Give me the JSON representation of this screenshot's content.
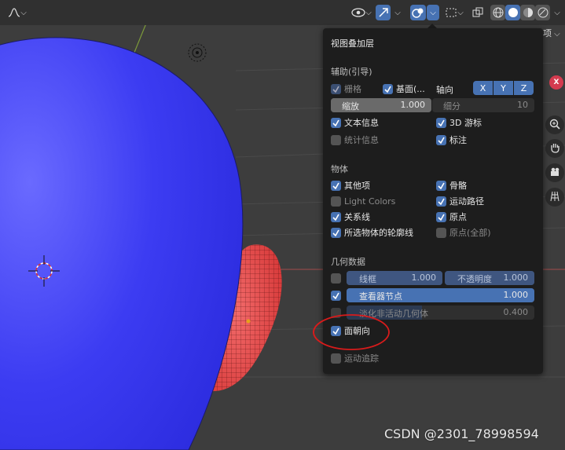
{
  "popover": {
    "title": "视图叠加层",
    "guides": {
      "heading": "辅助(引导)",
      "grid": "栅格",
      "floor": "基面(...",
      "axes_label": "轴向",
      "axes": [
        "X",
        "Y",
        "Z"
      ],
      "scale_label": "缩放",
      "scale_value": "1.000",
      "subdiv_label": "细分",
      "subdiv_value": "10",
      "text_info": "文本信息",
      "cursor_3d": "3D 游标",
      "stats": "统计信息",
      "annotations": "标注"
    },
    "objects": {
      "heading": "物体",
      "extras": "其他项",
      "bones": "骨骼",
      "light_colors": "Light Colors",
      "motion_paths": "运动路径",
      "relationship_lines": "关系线",
      "origins": "原点",
      "outline_selected": "所选物体的轮廓线",
      "origins_all": "原点(全部)"
    },
    "geometry": {
      "heading": "几何数据",
      "wireframe_label": "线框",
      "wireframe_value": "1.000",
      "opacity_label": "不透明度",
      "opacity_value": "1.000",
      "viewer_node_label": "查看器节点",
      "viewer_node_value": "1.000",
      "fade_inactive_label": "淡化非活动几何体",
      "fade_inactive_value": "0.400",
      "face_orientation": "面朝向",
      "motion_tracking": "运动追踪"
    }
  },
  "header": {
    "right_label": "选项"
  },
  "watermark": "CSDN @2301_78998594",
  "colors": {
    "accent": "#4772b3",
    "sphere": "#3a3aeb",
    "mesh": "#e84a4a",
    "highlight_circle": "#d81b1b"
  }
}
